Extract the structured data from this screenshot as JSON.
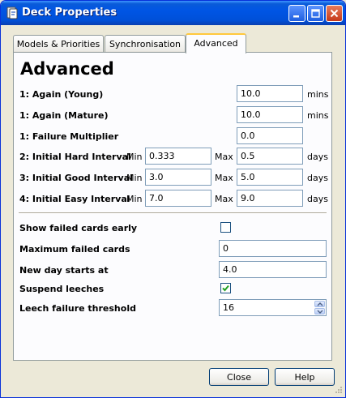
{
  "window": {
    "title": "Deck Properties",
    "accent": "#0055e5",
    "tab_highlight": "#ffc83c"
  },
  "tabs": [
    {
      "label": "Models & Priorities"
    },
    {
      "label": "Synchronisation"
    },
    {
      "label": "Advanced",
      "active": true
    }
  ],
  "panel": {
    "heading": "Advanced",
    "rows": {
      "again_young": {
        "label": "1: Again (Young)",
        "value": "10.0",
        "unit": "mins"
      },
      "again_mature": {
        "label": "1: Again (Mature)",
        "value": "10.0",
        "unit": "mins"
      },
      "failure_multiplier": {
        "label": "1: Failure Multiplier",
        "value": "0.0"
      },
      "hard_interval": {
        "label": "2: Initial Hard Interval",
        "min_label": "Min",
        "min": "0.333",
        "max_label": "Max",
        "max": "0.5",
        "unit": "days"
      },
      "good_interval": {
        "label": "3: Initial Good Interval",
        "min_label": "Min",
        "min": "3.0",
        "max_label": "Max",
        "max": "5.0",
        "unit": "days"
      },
      "easy_interval": {
        "label": "4: Initial Easy Interval",
        "min_label": "Min",
        "min": "7.0",
        "max_label": "Max",
        "max": "9.0",
        "unit": "days"
      }
    },
    "options": {
      "show_failed_early": {
        "label": "Show failed cards early",
        "checked": false
      },
      "max_failed": {
        "label": "Maximum failed cards",
        "value": "0"
      },
      "new_day": {
        "label": "New day starts at",
        "value": "4.0"
      },
      "suspend_leeches": {
        "label": "Suspend leeches",
        "checked": true
      },
      "leech_threshold": {
        "label": "Leech failure threshold",
        "value": "16"
      }
    }
  },
  "buttons": {
    "close": "Close",
    "help": "Help"
  },
  "icons": {
    "app": "deck-app-icon",
    "minimize": "minimize-icon",
    "maximize": "maximize-icon",
    "close": "close-icon",
    "check": "checkmark-icon",
    "spin_up": "spin-up-icon",
    "spin_down": "spin-down-icon",
    "grip": "resize-grip-icon"
  }
}
